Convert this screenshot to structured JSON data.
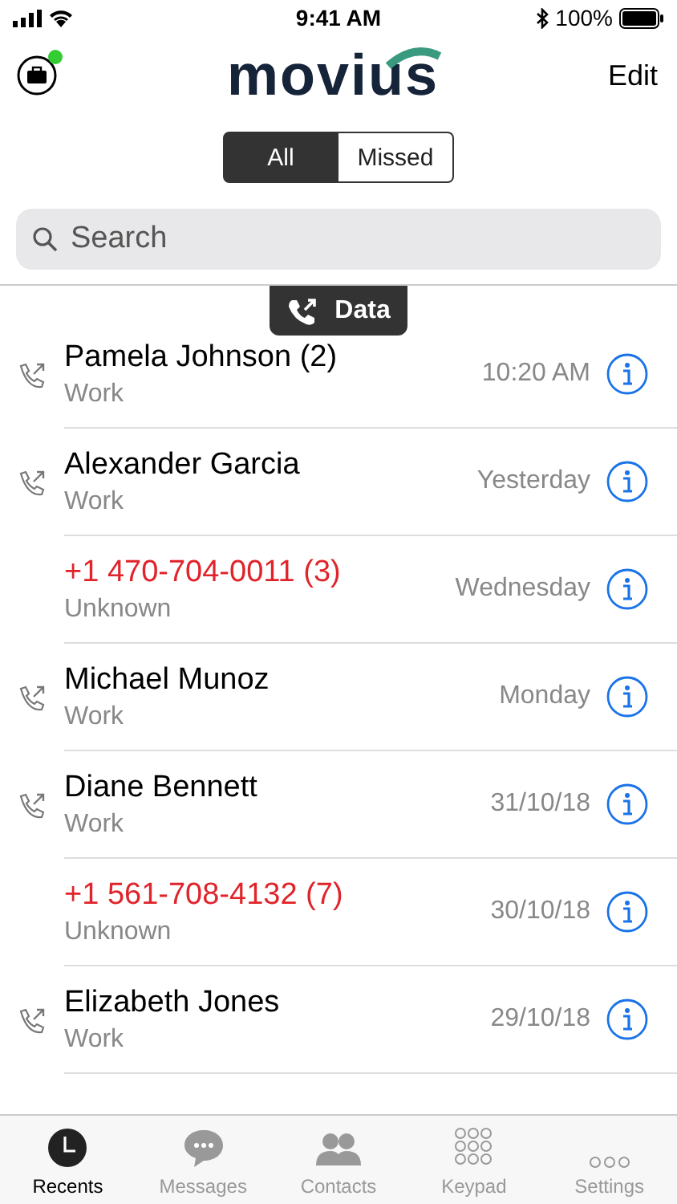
{
  "status_bar": {
    "time": "9:41 AM",
    "battery": "100%"
  },
  "header": {
    "logo": "movius",
    "edit": "Edit",
    "online": true
  },
  "segments": [
    {
      "label": "All",
      "selected": true
    },
    {
      "label": "Missed",
      "selected": false
    }
  ],
  "search": {
    "placeholder": "Search"
  },
  "badge": {
    "label": "Data"
  },
  "calls": [
    {
      "name": "Pamela Johnson (2)",
      "type": "Work",
      "time": "10:20 AM",
      "missed": false
    },
    {
      "name": "Alexander Garcia",
      "type": "Work",
      "time": "Yesterday",
      "missed": false
    },
    {
      "name": "+1 470-704-0011 (3)",
      "type": "Unknown",
      "time": "Wednesday",
      "missed": true
    },
    {
      "name": "Michael Munoz",
      "type": "Work",
      "time": "Monday",
      "missed": false
    },
    {
      "name": "Diane Bennett",
      "type": "Work",
      "time": "31/10/18",
      "missed": false
    },
    {
      "name": "+1 561-708-4132 (7)",
      "type": "Unknown",
      "time": "30/10/18",
      "missed": true
    },
    {
      "name": "Elizabeth Jones",
      "type": "Work",
      "time": "29/10/18",
      "missed": false
    }
  ],
  "tabs": [
    {
      "label": "Recents",
      "kind": "recents",
      "selected": true
    },
    {
      "label": "Messages",
      "kind": "messages",
      "selected": false
    },
    {
      "label": "Contacts",
      "kind": "contacts",
      "selected": false
    },
    {
      "label": "Keypad",
      "kind": "keypad",
      "selected": false
    },
    {
      "label": "Settings",
      "kind": "settings",
      "selected": false
    }
  ]
}
